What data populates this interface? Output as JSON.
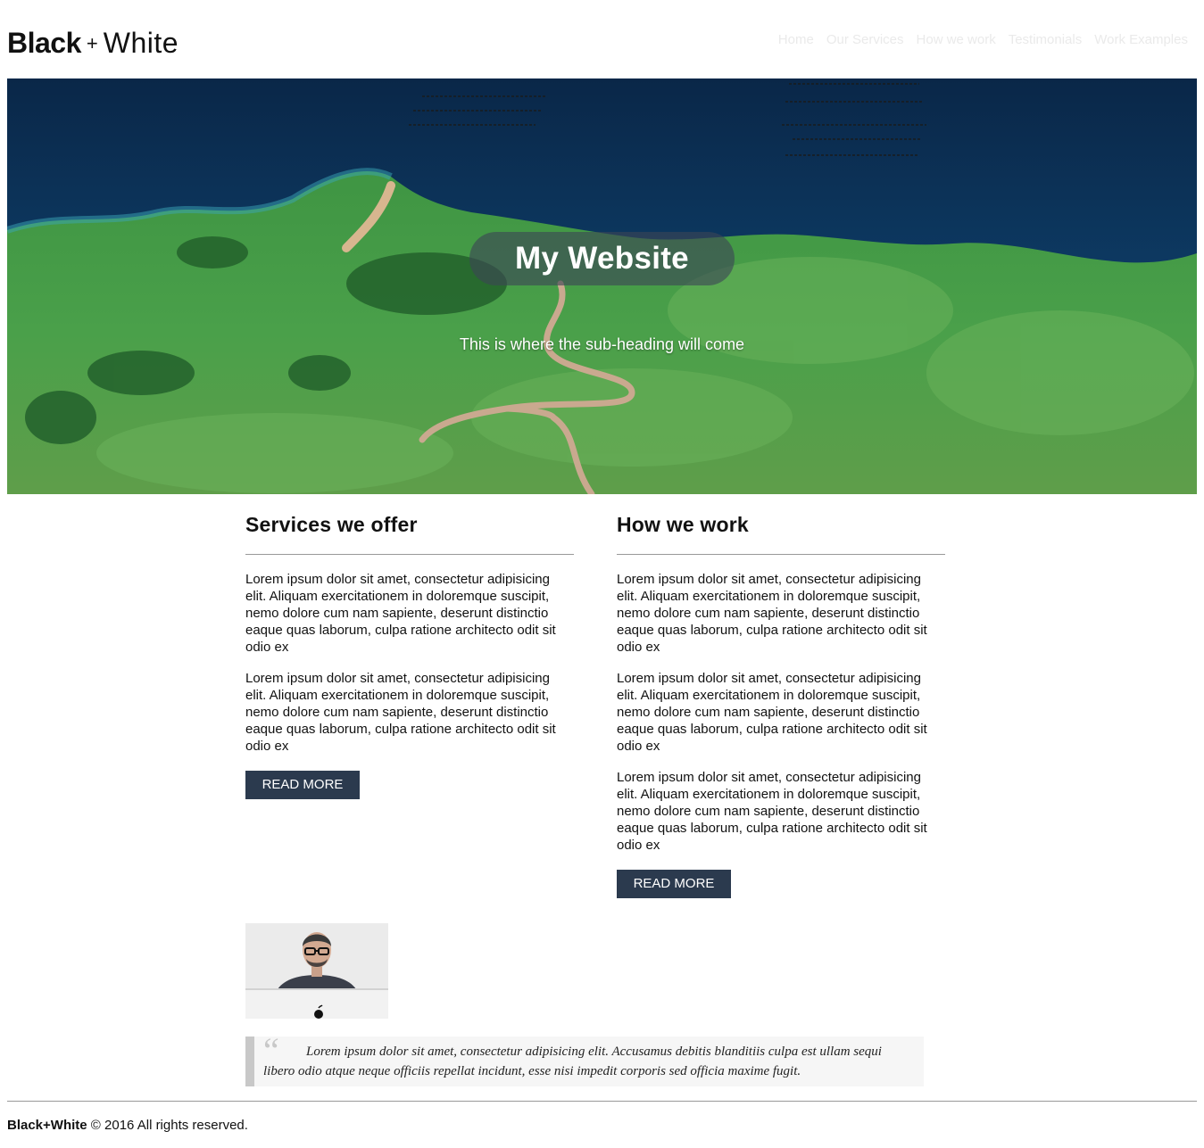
{
  "header": {
    "brand_black": "Black",
    "brand_plus": "+",
    "brand_white": "White",
    "nav": [
      {
        "label": "Home"
      },
      {
        "label": "Our Services"
      },
      {
        "label": "How we work"
      },
      {
        "label": "Testimonials"
      },
      {
        "label": "Work Examples"
      }
    ]
  },
  "hero": {
    "title": "My Website",
    "subtitle": "This is where the sub-heading will come"
  },
  "services": {
    "heading": "Services we offer",
    "paragraphs": [
      "Lorem ipsum dolor sit amet, consectetur adipisicing elit. Aliquam exercitationem in doloremque suscipit, nemo dolore cum nam sapiente, deserunt distinctio eaque quas laborum, culpa ratione architecto odit sit odio ex",
      "Lorem ipsum dolor sit amet, consectetur adipisicing elit. Aliquam exercitationem in doloremque suscipit, nemo dolore cum nam sapiente, deserunt distinctio eaque quas laborum, culpa ratione architecto odit sit odio ex"
    ],
    "button": "READ MORE"
  },
  "howwework": {
    "heading": "How we work",
    "paragraphs": [
      "Lorem ipsum dolor sit amet, consectetur adipisicing elit. Aliquam exercitationem in doloremque suscipit, nemo dolore cum nam sapiente, deserunt distinctio eaque quas laborum, culpa ratione architecto odit sit odio ex",
      "Lorem ipsum dolor sit amet, consectetur adipisicing elit. Aliquam exercitationem in doloremque suscipit, nemo dolore cum nam sapiente, deserunt distinctio eaque quas laborum, culpa ratione architecto odit sit odio ex",
      "Lorem ipsum dolor sit amet, consectetur adipisicing elit. Aliquam exercitationem in doloremque suscipit, nemo dolore cum nam sapiente, deserunt distinctio eaque quas laborum, culpa ratione architecto odit sit odio ex"
    ],
    "button": "READ MORE"
  },
  "testimonial": {
    "quote_mark": "“",
    "quote": "Lorem ipsum dolor sit amet, consectetur adipisicing elit. Accusamus debitis blanditiis culpa est ullam sequi libero odio atque neque officiis repellat incidunt, esse nisi impedit corporis sed officia maxime fugit."
  },
  "footer": {
    "brand": "Black+White",
    "copyright": "© 2016 All rights reserved."
  },
  "colors": {
    "button_bg": "#2b3a4e",
    "nav_text": "#eaeaea",
    "hero_title_bg": "rgba(60,70,85,0.62)"
  }
}
